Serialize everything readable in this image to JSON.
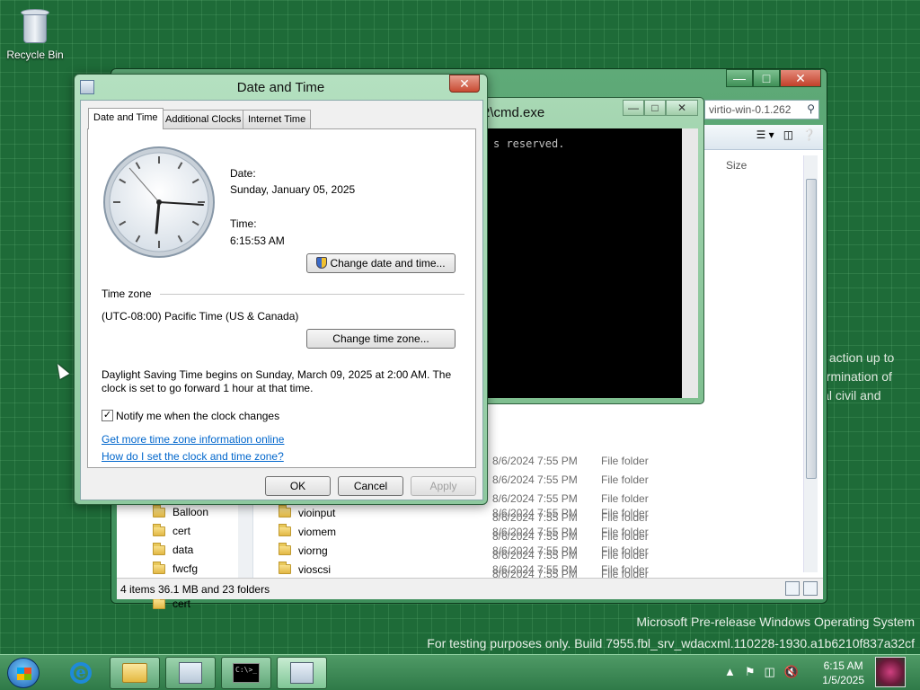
{
  "desktop": {
    "recycle_bin_label": "Recycle Bin",
    "watermark_line1": "Microsoft Pre-release Windows Operating System",
    "watermark_line2": "For testing purposes only. Build 7955.fbl_srv_wdacxml.110228-1930.a1b6210f837a32cf",
    "bg_text_lines": [
      "y action up to",
      "ermination of",
      "ial civil and"
    ]
  },
  "explorer": {
    "search_placeholder": "virtio-win-0.1.262",
    "column_size": "Size",
    "nav_items": [
      "Balloon",
      "cert",
      "data",
      "fwcfg"
    ],
    "rows": [
      {
        "name": "",
        "date": "8/6/2024 7:55 PM",
        "type": "File folder"
      },
      {
        "name": "",
        "date": "8/6/2024 7:55 PM",
        "type": "File folder"
      },
      {
        "name": "",
        "date": "8/6/2024 7:55 PM",
        "type": "File folder"
      },
      {
        "name": "",
        "date": "8/6/2024 7:55 PM",
        "type": "File folder"
      },
      {
        "name": "",
        "date": "8/6/2024 7:55 PM",
        "type": "File folder"
      },
      {
        "name": "",
        "date": "8/6/2024 7:55 PM",
        "type": "File folder"
      },
      {
        "name": "",
        "date": "8/6/2024 7:55 PM",
        "type": "File folder"
      },
      {
        "name": "vioinput",
        "date": "8/6/2024 7:55 PM",
        "type": "File folder"
      },
      {
        "name": "viomem",
        "date": "8/6/2024 7:55 PM",
        "type": "File folder"
      },
      {
        "name": "viorng",
        "date": "8/6/2024 7:55 PM",
        "type": "File folder"
      },
      {
        "name": "vioscsi",
        "date": "8/6/2024 7:55 PM",
        "type": "File folder"
      }
    ],
    "status_text": "4 items 36.1 MB and 23 folders"
  },
  "cmd": {
    "title": "2\\cmd.exe",
    "line1": "s reserved."
  },
  "dialog": {
    "title": "Date and Time",
    "tabs": [
      "Date and Time",
      "Additional Clocks",
      "Internet Time"
    ],
    "date_label": "Date:",
    "date_value": "Sunday, January 05, 2025",
    "time_label": "Time:",
    "time_value": "6:15:53 AM",
    "change_datetime_btn": "Change date and time...",
    "timezone_heading": "Time zone",
    "timezone_value": "(UTC-08:00) Pacific Time (US & Canada)",
    "change_tz_btn": "Change time zone...",
    "dst_line1": "Daylight Saving Time begins on Sunday, March 09, 2025 at 2:00 AM. The",
    "dst_line2": "clock is set to go forward 1 hour at that time.",
    "notify_label": "Notify me when the clock changes",
    "link1": "Get more time zone information online",
    "link2": "How do I set the clock and time zone?",
    "ok": "OK",
    "cancel": "Cancel",
    "apply": "Apply"
  },
  "taskbar": {
    "time": "6:15 AM",
    "date": "1/5/2025"
  }
}
